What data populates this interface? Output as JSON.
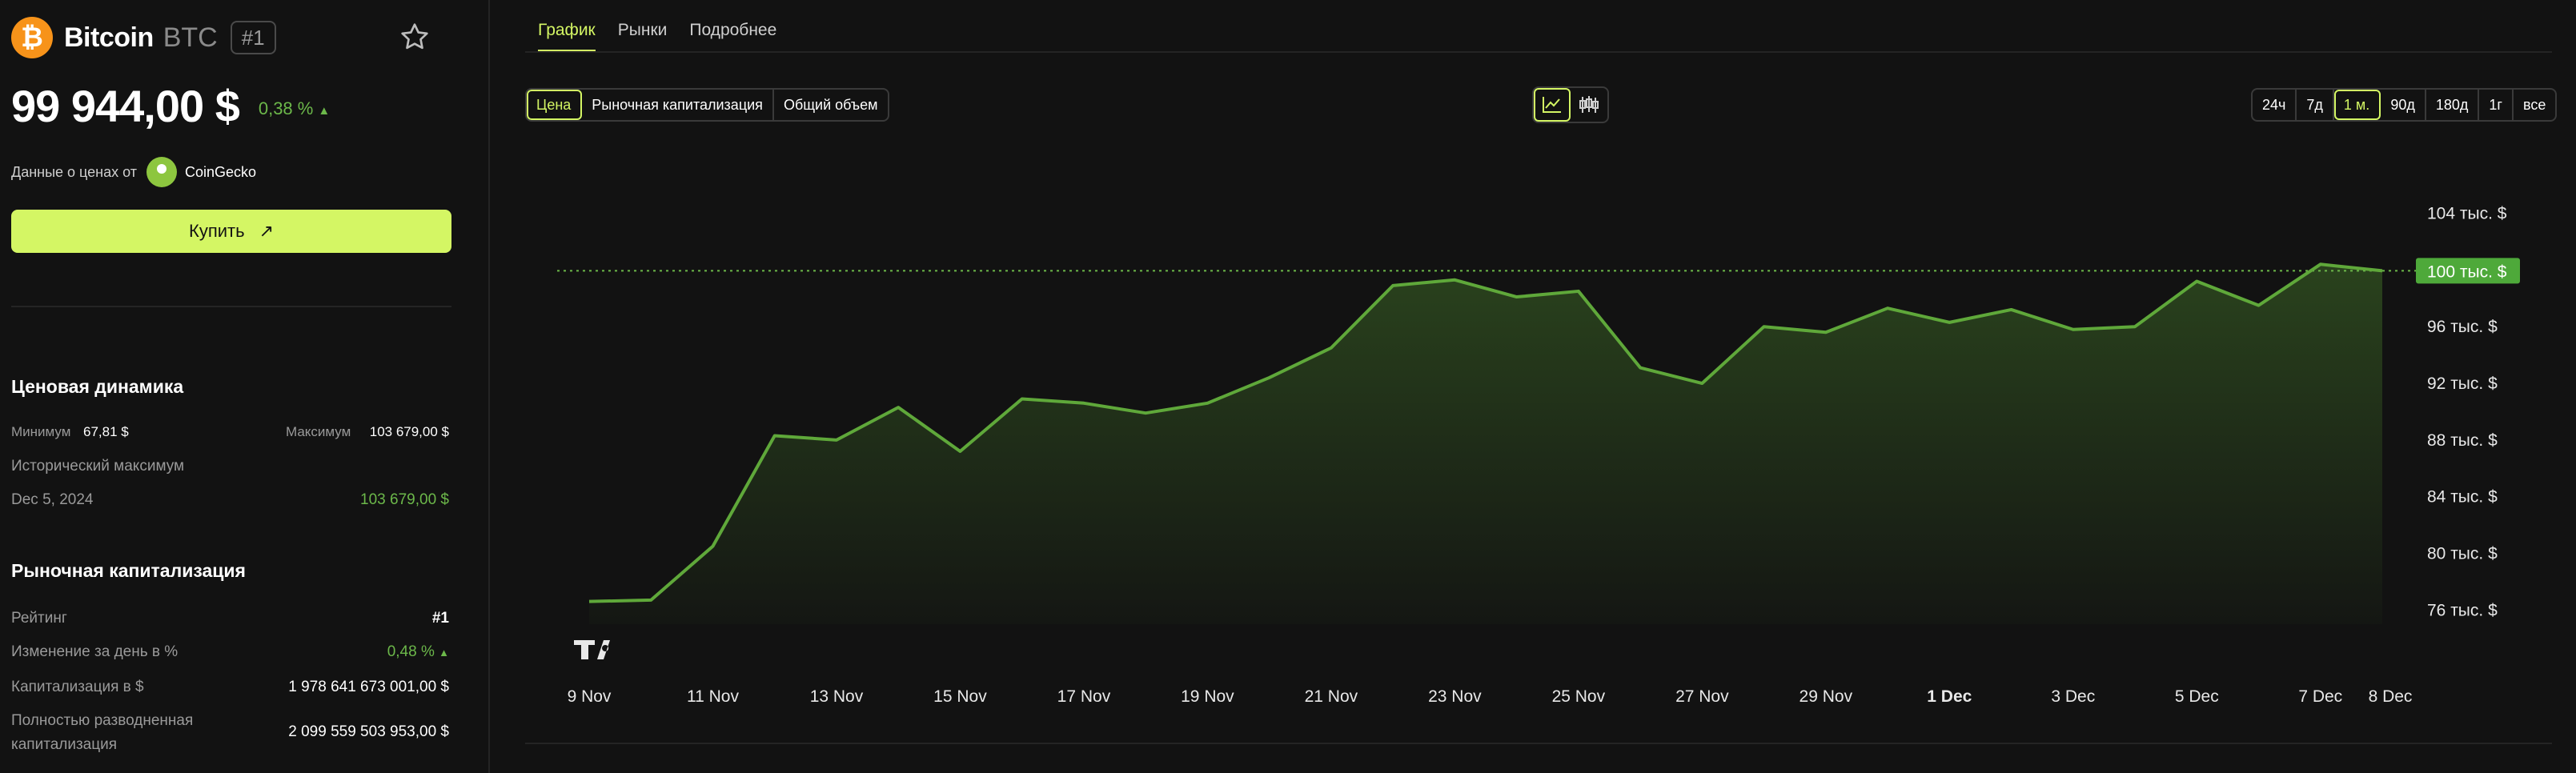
{
  "coin": {
    "logo_glyph": "₿",
    "name": "Bitcoin",
    "ticker": "BTC",
    "rank": "#1",
    "price": "99 944,00 $",
    "change": "0,38 %",
    "change_arrow": "▲"
  },
  "source": {
    "label": "Данные о ценах от",
    "name": "CoinGecko"
  },
  "buy": {
    "label": "Купить",
    "icon": "↗"
  },
  "dynamics": {
    "title": "Ценовая динамика",
    "min_label": "Минимум",
    "min_value": "67,81 $",
    "max_label": "Максимум",
    "max_value": "103 679,00 $",
    "ath_label": "Исторический максимум",
    "ath_date": "Dec 5, 2024",
    "ath_value": "103 679,00 $"
  },
  "market_cap": {
    "title": "Рыночная капитализация",
    "rating_label": "Рейтинг",
    "rating_value": "#1",
    "day_change_label": "Изменение за день в %",
    "day_change_value": "0,48 %",
    "day_change_arrow": "▲",
    "cap_label": "Капитализация в $",
    "cap_value": "1 978 641 673 001,00 $",
    "fdv_label_line1": "Полностью разводненная",
    "fdv_label_line2": "капитализация",
    "fdv_value": "2 099 559 503 953,00 $"
  },
  "tabs": [
    "График",
    "Рынки",
    "Подробнее"
  ],
  "metric_options": [
    "Цена",
    "Рыночная капитализация",
    "Общий объем"
  ],
  "range_options": [
    "24ч",
    "7д",
    "1 м.",
    "90д",
    "180д",
    "1г",
    "все"
  ],
  "colors": {
    "accent": "#d4f664",
    "up": "#6cb84a",
    "line": "#5fa83a"
  },
  "icons": {
    "line_chart": "line-chart-icon",
    "candles": "candlestick-icon",
    "star": "star-icon"
  },
  "chart_data": {
    "type": "area",
    "x_ticks": [
      "9 Nov",
      "11 Nov",
      "13 Nov",
      "15 Nov",
      "17 Nov",
      "19 Nov",
      "21 Nov",
      "23 Nov",
      "25 Nov",
      "27 Nov",
      "29 Nov",
      "1 Dec",
      "3 Dec",
      "5 Dec",
      "7 Dec",
      "8 Dec"
    ],
    "y_ticks": [
      "104 тыс. $",
      "100 тыс. $",
      "96 тыс. $",
      "92 тыс. $",
      "88 тыс. $",
      "84 тыс. $",
      "80 тыс. $",
      "76 тыс. $"
    ],
    "current_label": "100 тыс. $",
    "current_value": 99944,
    "ylim": [
      75000,
      105500
    ],
    "x": [
      "2024-11-09",
      "2024-11-10",
      "2024-11-11",
      "2024-11-12",
      "2024-11-13",
      "2024-11-14",
      "2024-11-15",
      "2024-11-16",
      "2024-11-17",
      "2024-11-18",
      "2024-11-19",
      "2024-11-20",
      "2024-11-21",
      "2024-11-22",
      "2024-11-23",
      "2024-11-24",
      "2024-11-25",
      "2024-11-26",
      "2024-11-27",
      "2024-11-28",
      "2024-11-29",
      "2024-11-30",
      "2024-12-01",
      "2024-12-02",
      "2024-12-03",
      "2024-12-04",
      "2024-12-05",
      "2024-12-06",
      "2024-12-07",
      "2024-12-08"
    ],
    "values": [
      76600,
      76700,
      80500,
      88300,
      88000,
      90300,
      87200,
      90900,
      90600,
      89900,
      90600,
      92400,
      94500,
      98900,
      99300,
      98100,
      98500,
      93100,
      92000,
      96000,
      95600,
      97300,
      96300,
      97200,
      95800,
      96000,
      99200,
      97500,
      100400,
      99944
    ]
  }
}
